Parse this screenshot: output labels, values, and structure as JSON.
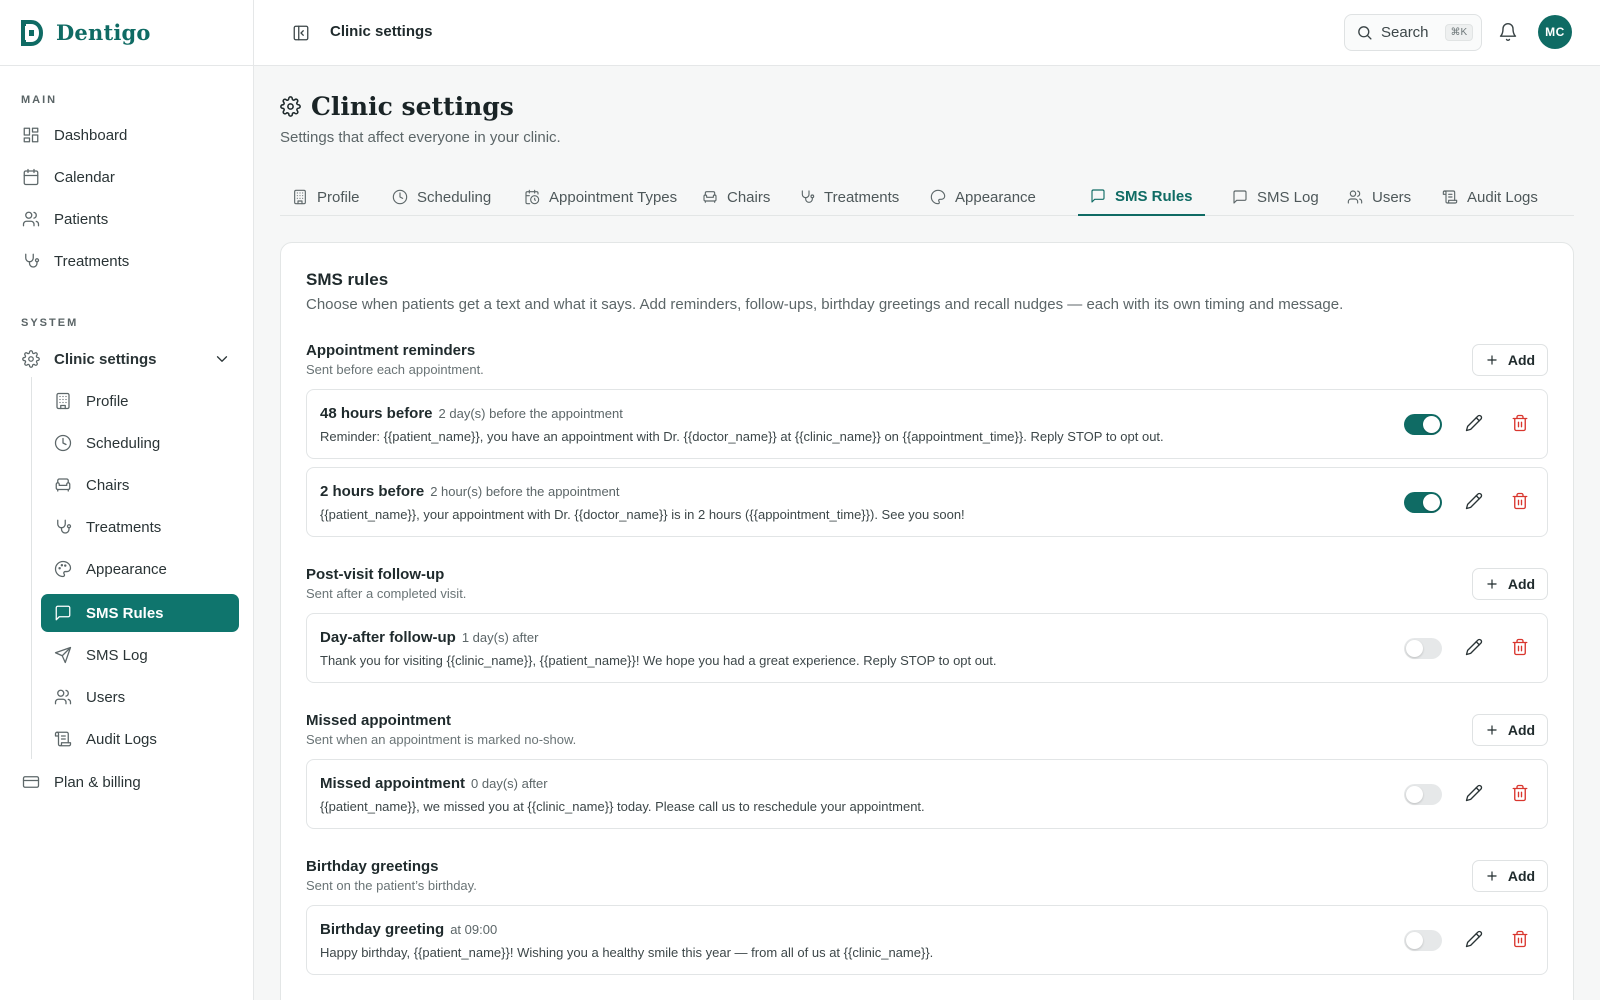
{
  "brand": {
    "name": "Dentigo"
  },
  "sidebar": {
    "main_label": "MAIN",
    "main_items": [
      {
        "label": "Dashboard",
        "icon": "dashboard-icon"
      },
      {
        "label": "Calendar",
        "icon": "calendar-icon"
      },
      {
        "label": "Patients",
        "icon": "users-icon"
      },
      {
        "label": "Treatments",
        "icon": "stethoscope-icon"
      }
    ],
    "system_label": "SYSTEM",
    "clinic_settings": {
      "label": "Clinic settings",
      "icon": "gear-icon",
      "expanded": true
    },
    "sub_items": [
      {
        "label": "Profile",
        "icon": "building-icon"
      },
      {
        "label": "Scheduling",
        "icon": "clock-icon"
      },
      {
        "label": "Chairs",
        "icon": "armchair-icon"
      },
      {
        "label": "Treatments",
        "icon": "stethoscope-icon"
      },
      {
        "label": "Appearance",
        "icon": "palette-icon"
      },
      {
        "label": "SMS Rules",
        "icon": "message-square-icon",
        "active": true
      },
      {
        "label": "SMS Log",
        "icon": "send-icon"
      },
      {
        "label": "Users",
        "icon": "users-icon"
      },
      {
        "label": "Audit Logs",
        "icon": "scroll-icon"
      }
    ],
    "billing": {
      "label": "Plan & billing",
      "icon": "credit-card-icon"
    }
  },
  "topbar": {
    "breadcrumb": "Clinic settings",
    "search_label": "Search",
    "search_shortcut": "⌘K",
    "avatar_initials": "MC"
  },
  "page": {
    "title": "Clinic settings",
    "subtitle": "Settings that affect everyone in your clinic."
  },
  "tabs": [
    {
      "label": "Profile",
      "icon": "building-icon"
    },
    {
      "label": "Scheduling",
      "icon": "clock-icon"
    },
    {
      "label": "Appointment Types",
      "icon": "calendar-clock-icon"
    },
    {
      "label": "Chairs",
      "icon": "armchair-icon"
    },
    {
      "label": "Treatments",
      "icon": "stethoscope-icon"
    },
    {
      "label": "Appearance",
      "icon": "palette-icon"
    },
    {
      "label": "SMS Rules",
      "icon": "message-square-icon",
      "active": true
    },
    {
      "label": "SMS Log",
      "icon": "message-square-icon"
    },
    {
      "label": "Users",
      "icon": "users-icon"
    },
    {
      "label": "Audit Logs",
      "icon": "scroll-icon"
    }
  ],
  "sms_rules": {
    "title": "SMS rules",
    "description": "Choose when patients get a text and what it says. Add reminders, follow-ups, birthday greetings and recall nudges — each with its own timing and message.",
    "add_label": "Add",
    "groups": [
      {
        "title": "Appointment reminders",
        "subtitle": "Sent before each appointment.",
        "rules": [
          {
            "name": "48 hours before",
            "timing": "2 day(s) before the appointment",
            "message": "Reminder: {{patient_name}}, you have an appointment with Dr. {{doctor_name}} at {{clinic_name}} on {{appointment_time}}. Reply STOP to opt out.",
            "enabled": true
          },
          {
            "name": "2 hours before",
            "timing": "2 hour(s) before the appointment",
            "message": "{{patient_name}}, your appointment with Dr. {{doctor_name}} is in 2 hours ({{appointment_time}}). See you soon!",
            "enabled": true
          }
        ]
      },
      {
        "title": "Post-visit follow-up",
        "subtitle": "Sent after a completed visit.",
        "rules": [
          {
            "name": "Day-after follow-up",
            "timing": "1 day(s) after",
            "message": "Thank you for visiting {{clinic_name}}, {{patient_name}}! We hope you had a great experience. Reply STOP to opt out.",
            "enabled": false
          }
        ]
      },
      {
        "title": "Missed appointment",
        "subtitle": "Sent when an appointment is marked no-show.",
        "rules": [
          {
            "name": "Missed appointment",
            "timing": "0 day(s) after",
            "message": "{{patient_name}}, we missed you at {{clinic_name}} today. Please call us to reschedule your appointment.",
            "enabled": false
          }
        ]
      },
      {
        "title": "Birthday greetings",
        "subtitle": "Sent on the patient’s birthday.",
        "rules": [
          {
            "name": "Birthday greeting",
            "timing": "at 09:00",
            "message": "Happy birthday, {{patient_name}}! Wishing you a healthy smile this year — from all of us at {{clinic_name}}.",
            "enabled": false
          }
        ]
      }
    ]
  },
  "colors": {
    "brand": "#0f6b64",
    "active_nav": "#0f756d",
    "danger": "#d9362e"
  }
}
